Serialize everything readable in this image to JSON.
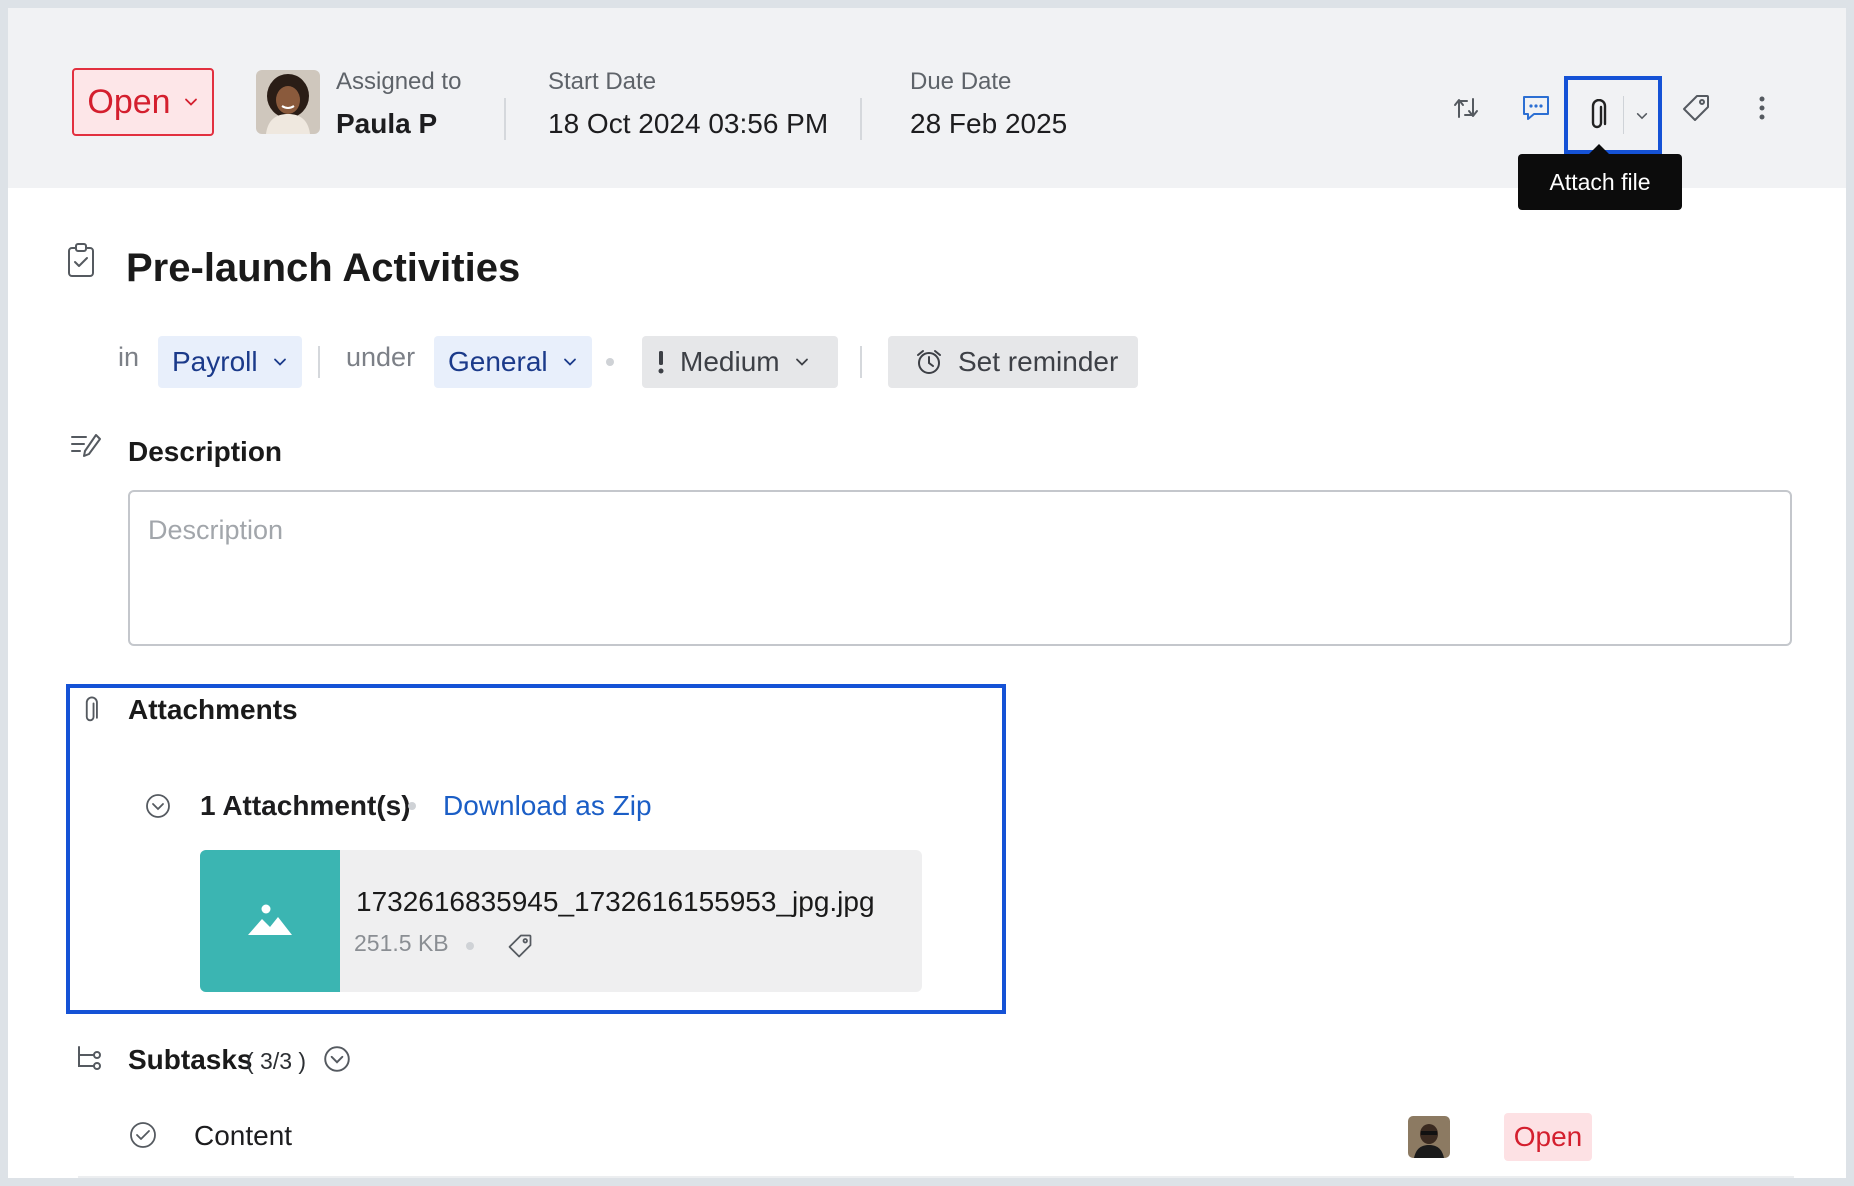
{
  "header": {
    "status": "Open",
    "assigned_label": "Assigned to",
    "assigned_name": "Paula P",
    "start_label": "Start Date",
    "start_value": "18 Oct 2024 03:56 PM",
    "due_label": "Due Date",
    "due_value": "28 Feb 2025",
    "tooltip": "Attach file",
    "tool_icons": [
      "sync-icon",
      "comment-icon",
      "paperclip-icon",
      "chevron-down-icon",
      "tag-icon",
      "more-vertical-icon"
    ]
  },
  "task": {
    "title": "Pre-launch Activities",
    "in_label": "in",
    "project": "Payroll",
    "under_label": "under",
    "tasklist": "General",
    "priority": "Medium",
    "reminder": "Set reminder"
  },
  "description": {
    "heading": "Description",
    "placeholder": "Description"
  },
  "attachments": {
    "heading": "Attachments",
    "count_label": "1 Attachment(s)",
    "download_label": "Download as Zip",
    "files": [
      {
        "name": "1732616835945_1732616155953_jpg.jpg",
        "size": "251.5 KB"
      }
    ]
  },
  "subtasks": {
    "heading": "Subtasks",
    "count": "( 3/3 )",
    "items": [
      {
        "name": "Content",
        "status": "Open"
      }
    ]
  },
  "colors": {
    "accent_blue": "#1552d6",
    "status_red": "#d41f2e",
    "thumb_teal": "#3bb5b2"
  }
}
